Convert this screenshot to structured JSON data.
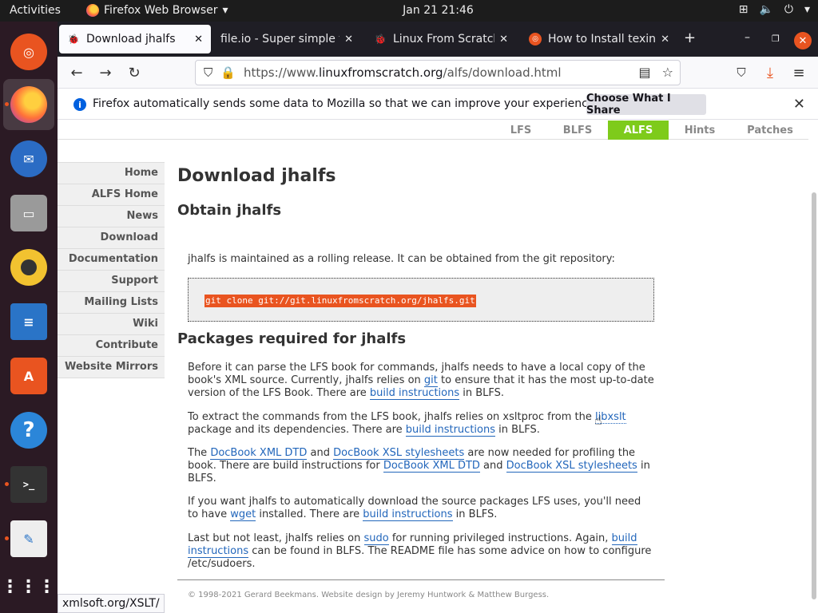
{
  "topbar": {
    "activities": "Activities",
    "app_menu": "Firefox Web Browser",
    "clock": "Jan 21  21:46"
  },
  "dock": {
    "items": [
      "ubuntu-software-logo",
      "firefox",
      "thunderbird",
      "files",
      "rhythmbox",
      "libreoffice-writer",
      "ubuntu-software",
      "help",
      "terminal",
      "text-editor",
      "show-applications"
    ]
  },
  "tabs": [
    {
      "title": "Download jhalfs",
      "active": true
    },
    {
      "title": "file.io - Super simple file",
      "active": false
    },
    {
      "title": "Linux From Scratch",
      "active": false
    },
    {
      "title": "How to Install texinfo",
      "active": false
    }
  ],
  "navbar": {
    "url_prefix": "https://www.",
    "url_domain": "linuxfromscratch.org",
    "url_path": "/alfs/download.html"
  },
  "notice": {
    "message": "Firefox automatically sends some data to Mozilla so that we can improve your experience.",
    "button": "Choose What I Share"
  },
  "site_tabs": [
    "LFS",
    "BLFS",
    "ALFS",
    "Hints",
    "Patches"
  ],
  "sidebar": [
    "Home",
    "ALFS Home",
    "News",
    "Download",
    "Documentation",
    "Support",
    "Mailing Lists",
    "Wiki",
    "Contribute",
    "Website Mirrors"
  ],
  "content": {
    "h1": "Download jhalfs",
    "h2_obtain": "Obtain jhalfs",
    "p_obtain": "jhalfs is maintained as a rolling release. It can be obtained from the git repository:",
    "code": "git clone git://git.linuxfromscratch.org/jhalfs.git",
    "h2_packages": "Packages required for jhalfs",
    "p1_a": "Before it can parse the LFS book for commands, jhalfs needs to have a local copy of the book's XML source. Currently, jhalfs relies on ",
    "p1_git": "git",
    "p1_b": " to ensure that it has the most up-to-date version of the LFS Book. There are ",
    "p1_link": "build instructions",
    "p1_c": " in BLFS.",
    "p2_a": "To extract the commands from the LFS book, jhalfs relies on xsltproc from the ",
    "p2_libxslt": "libxslt",
    "p2_b": " package and its dependencies. There are ",
    "p2_link": "build instructions",
    "p2_c": " in BLFS.",
    "p3_a": "The ",
    "p3_dtd": "DocBook XML DTD",
    "p3_b": " and ",
    "p3_xsl": "DocBook XSL stylesheets",
    "p3_c": " are now needed for profiling the book. There are build instructions for ",
    "p3_dtd2": "DocBook XML DTD",
    "p3_d": " and ",
    "p3_xsl2": "DocBook XSL stylesheets",
    "p3_e": " in BLFS.",
    "p4_a": "If you want jhalfs to automatically download the source packages LFS uses, you'll need to have ",
    "p4_wget": "wget",
    "p4_b": " installed. There are ",
    "p4_link": "build instructions",
    "p4_c": " in BLFS.",
    "p5_a": "Last but not least, jhalfs relies on ",
    "p5_sudo": "sudo",
    "p5_b": " for running privileged instructions. Again, ",
    "p5_link": "build instructions",
    "p5_c": " can be found in BLFS. The README file has some advice on how to configure /etc/sudoers."
  },
  "footer": "© 1998-2021 Gerard Beekmans. Website design by Jeremy Huntwork & Matthew Burgess.",
  "statusbar": "xmlsoft.org/XSLT/"
}
